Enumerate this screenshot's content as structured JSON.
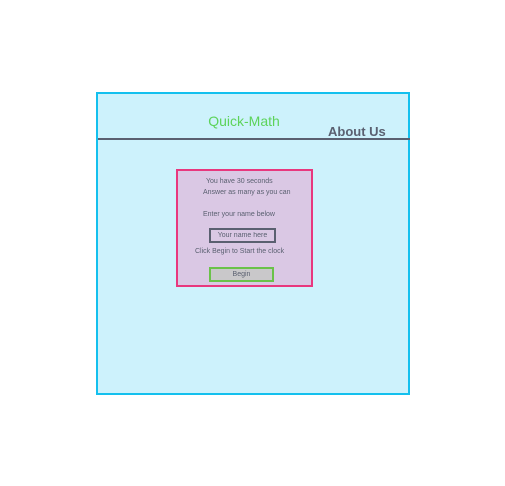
{
  "header": {
    "title": "Quick-Math",
    "about_link": "About Us"
  },
  "panel": {
    "line1": "You have 30 seconds",
    "line2": "Answer as many as you can",
    "name_prompt": "Enter your name below",
    "name_input_value": "",
    "name_input_placeholder": "Your name here",
    "instruction": "Click Begin to Start the clock",
    "begin_label": "Begin"
  },
  "colors": {
    "frame_bg": "#cdf2fc",
    "frame_border": "#13c0ee",
    "title": "#5dd35a",
    "panel_bg": "#dac8e4",
    "panel_border": "#e8387e",
    "button_border": "#6ac249",
    "text": "#5a6070"
  }
}
